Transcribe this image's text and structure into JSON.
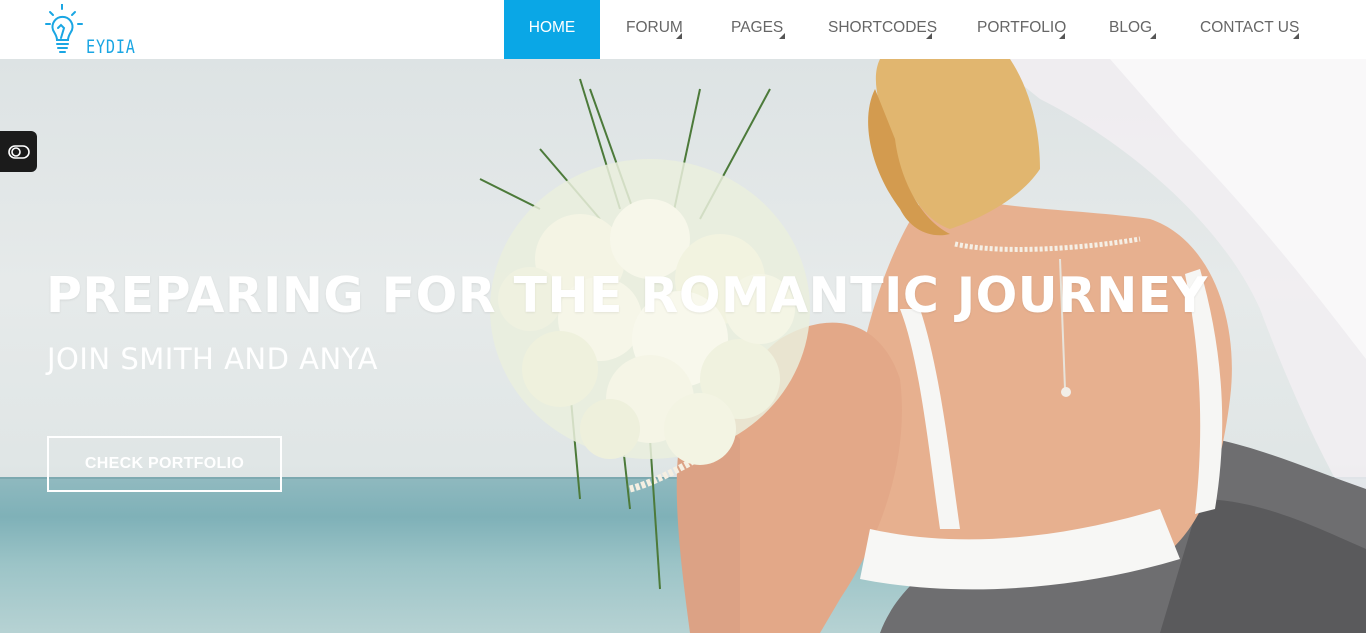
{
  "logo": {
    "text": "EYDIA",
    "icon": "lightbulb-icon",
    "color": "#1aa6e3"
  },
  "nav": {
    "items": [
      {
        "label": "HOME",
        "active": true,
        "has_submenu": false
      },
      {
        "label": "FORUM",
        "active": false,
        "has_submenu": true
      },
      {
        "label": "PAGES",
        "active": false,
        "has_submenu": true
      },
      {
        "label": "SHORTCODES",
        "active": false,
        "has_submenu": true
      },
      {
        "label": "PORTFOLIO",
        "active": false,
        "has_submenu": true
      },
      {
        "label": "BLOG",
        "active": false,
        "has_submenu": true
      },
      {
        "label": "CONTACT US",
        "active": false,
        "has_submenu": true
      }
    ],
    "active_color": "#0aa7e6"
  },
  "hero": {
    "title": "PREPARING FOR THE ROMANTIC JOURNEY",
    "subtitle": "JOIN SMITH AND ANYA",
    "cta_label": "CHECK PORTFOLIO",
    "toggle_icon": "toggle-icon"
  }
}
